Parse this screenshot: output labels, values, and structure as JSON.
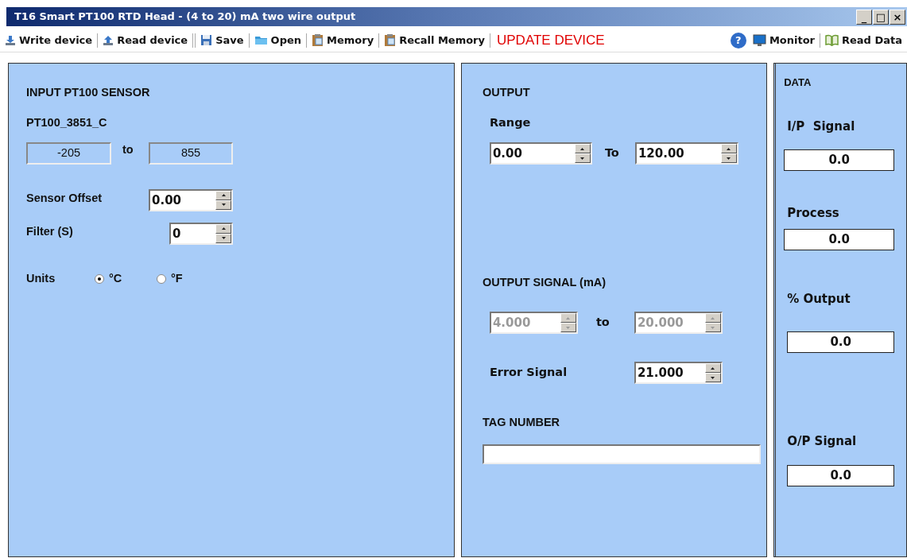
{
  "window": {
    "title": "T16 Smart PT100 RTD Head - (4 to 20) mA two wire output",
    "controls": [
      "_",
      "□",
      "×"
    ]
  },
  "toolbar": [
    {
      "kind": "button",
      "label": "Write device"
    },
    {
      "kind": "button",
      "label": "Read device"
    },
    {
      "kind": "button",
      "label": "Save"
    },
    {
      "kind": "button",
      "label": "Open"
    },
    {
      "kind": "button",
      "label": "Memory"
    },
    {
      "kind": "button",
      "label": "Recall Memory"
    },
    {
      "kind": "alert",
      "label": "UPDATE DEVICE"
    },
    {
      "kind": "help",
      "label": "?"
    },
    {
      "kind": "button",
      "label": "Monitor"
    },
    {
      "kind": "button",
      "label": "Read Data"
    }
  ],
  "input": {
    "heading": "INPUT PT100 SENSOR",
    "sensor": "PT100_3851_C",
    "range_low": "-205",
    "range_sep": "to",
    "range_high": "855",
    "offset": {
      "label": "Sensor Offset",
      "value": "0.00",
      "disabled": false
    },
    "filter": {
      "label": "Filter (S)",
      "value": "0",
      "disabled": false
    },
    "units": {
      "label": "Units",
      "options": [
        {
          "label": "°C",
          "selected": true
        },
        {
          "label": "°F",
          "selected": false
        }
      ]
    }
  },
  "output": {
    "heading": "OUTPUT",
    "range_label": "Range",
    "range_low": {
      "value": "0.00",
      "disabled": false
    },
    "range_sep": "To",
    "range_high": {
      "value": "120.00",
      "disabled": false
    },
    "signal_heading": "OUTPUT SIGNAL (mA)",
    "signal_low": {
      "value": "4.000",
      "disabled": true
    },
    "signal_sep": "to",
    "signal_high": {
      "value": "20.000",
      "disabled": true
    },
    "error_label": "Error Signal",
    "error": {
      "value": "21.000",
      "disabled": false
    },
    "tag_heading": "TAG NUMBER"
  },
  "data": {
    "heading": "DATA",
    "readings": [
      {
        "label": "I/P  Signal",
        "value": "0.0"
      },
      {
        "label": "Process",
        "value": "0.0"
      },
      {
        "label": "% Output",
        "value": "0.0"
      },
      {
        "label": "O/P Signal",
        "value": "0.0"
      }
    ]
  }
}
